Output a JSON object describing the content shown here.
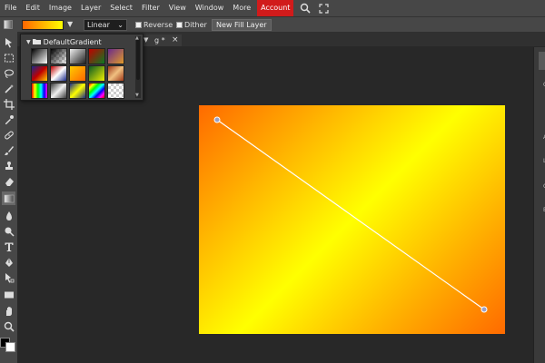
{
  "menu": [
    "File",
    "Edit",
    "Image",
    "Layer",
    "Select",
    "Filter",
    "View",
    "Window",
    "More"
  ],
  "account_label": "Account",
  "options": {
    "gradient_type": "Linear",
    "reverse_label": "Reverse",
    "dither_label": "Dither",
    "new_fill_layer_label": "New Fill Layer"
  },
  "gradient_popup": {
    "folder_name": "DefaultGradient",
    "swatch_count": 20
  },
  "document_tab": {
    "title": "g *",
    "close": "×"
  },
  "colors": {
    "accent_account": "#d11b1b",
    "gradient_start": "#ff6600",
    "gradient_end": "#ffff00",
    "ui_bar": "#474747",
    "workspace": "#282828"
  },
  "tools": [
    "move-tool-icon",
    "marquee-tool-icon",
    "lasso-tool-icon",
    "magic-wand-tool-icon",
    "crop-tool-icon",
    "eyedropper-tool-icon",
    "healing-tool-icon",
    "brush-tool-icon",
    "clone-stamp-tool-icon",
    "eraser-tool-icon",
    "gradient-tool-icon",
    "blur-tool-icon",
    "dodge-tool-icon",
    "text-tool-icon",
    "pen-tool-icon",
    "path-select-tool-icon",
    "shape-tool-icon",
    "hand-tool-icon",
    "zoom-tool-icon"
  ],
  "right_panel_letters": [
    "L",
    "G",
    "A",
    "L",
    "C",
    "E"
  ]
}
